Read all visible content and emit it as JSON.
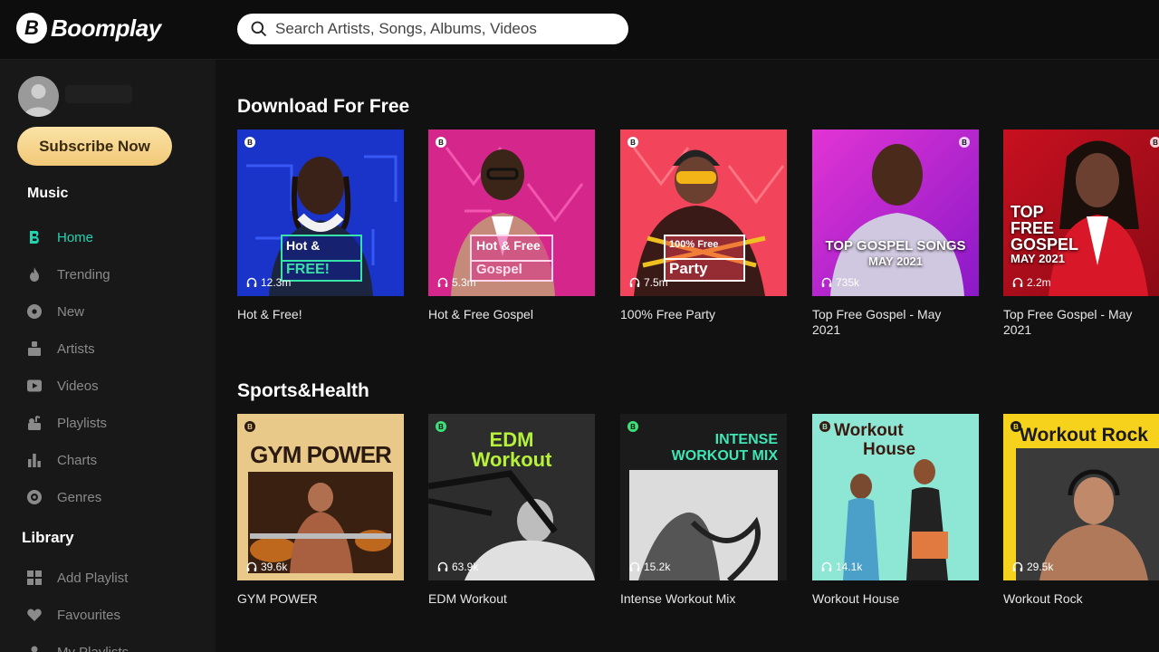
{
  "app": {
    "name": "Boomplay",
    "logo_letter": "B"
  },
  "search": {
    "placeholder": "Search Artists, Songs, Albums, Videos"
  },
  "sidebar": {
    "subscribe_label": "Subscribe Now",
    "music_heading": "Music",
    "library_heading": "Library",
    "music_items": [
      {
        "label": "Home",
        "icon": "boomplay-icon",
        "active": true
      },
      {
        "label": "Trending",
        "icon": "flame-icon"
      },
      {
        "label": "New",
        "icon": "disc-icon"
      },
      {
        "label": "Artists",
        "icon": "artist-icon"
      },
      {
        "label": "Videos",
        "icon": "video-icon"
      },
      {
        "label": "Playlists",
        "icon": "playlist-icon"
      },
      {
        "label": "Charts",
        "icon": "bar-chart-icon"
      },
      {
        "label": "Genres",
        "icon": "genres-icon"
      }
    ],
    "library_items": [
      {
        "label": "Add Playlist",
        "icon": "add-playlist-icon"
      },
      {
        "label": "Favourites",
        "icon": "heart-icon"
      },
      {
        "label": "My Playlists",
        "icon": "my-playlists-icon"
      }
    ]
  },
  "sections": [
    {
      "title": "Download For Free",
      "cards": [
        {
          "title": "Hot & Free!",
          "plays": "12.3m",
          "badge_line1": "Hot &",
          "badge_line2": "FREE!"
        },
        {
          "title": "Hot & Free Gospel",
          "plays": "5.3m",
          "badge_line1": "Hot & Free",
          "badge_line2": "Gospel"
        },
        {
          "title": "100% Free Party",
          "plays": "7.5m",
          "badge_line1": "100% Free",
          "badge_line2": "Party"
        },
        {
          "title": "Top Free Gospel - May 2021",
          "plays": "735k",
          "cover_line1": "TOP GOSPEL SONGS",
          "cover_line2": "MAY 2021"
        },
        {
          "title": "Top Free Gospel - May 2021",
          "plays": "2.2m",
          "cover_line1": "TOP",
          "cover_line2": "FREE",
          "cover_line3": "GOSPEL",
          "cover_line4": "MAY 2021"
        }
      ]
    },
    {
      "title": "Sports&Health",
      "cards": [
        {
          "title": "GYM POWER",
          "plays": "39.6k",
          "cover_text": "GYM POWER"
        },
        {
          "title": "EDM Workout",
          "plays": "63.9k",
          "cover_line1": "EDM",
          "cover_line2": "Workout"
        },
        {
          "title": "Intense Workout Mix",
          "plays": "15.2k",
          "cover_line1": "INTENSE",
          "cover_line2": "WORKOUT MIX"
        },
        {
          "title": "Workout House",
          "plays": "14.1k",
          "cover_line1": "Workout",
          "cover_line2": "House"
        },
        {
          "title": "Workout Rock",
          "plays": "29.5k",
          "cover_text": "Workout Rock"
        }
      ]
    }
  ],
  "colors": {
    "accent": "#22d3b2",
    "subscribe": "#f4d08a",
    "background": "#111111",
    "sidebar": "#181818"
  }
}
